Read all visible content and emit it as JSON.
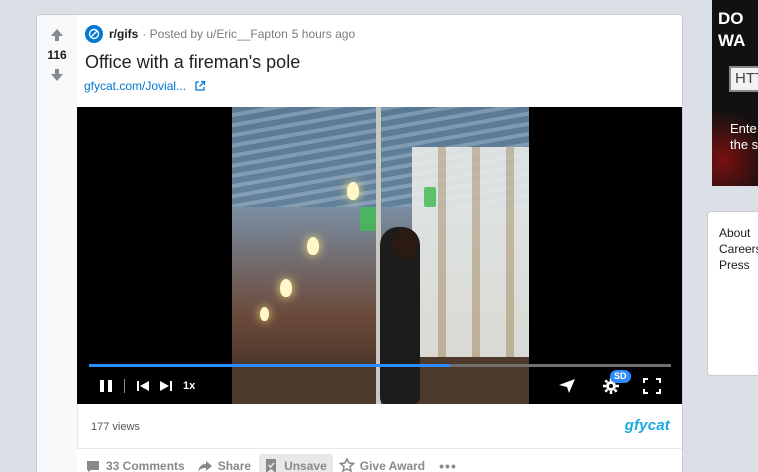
{
  "post": {
    "score": "116",
    "subreddit": "r/gifs",
    "posted_by": "· Posted by u/Eric__Fapton",
    "time_ago": "5 hours ago",
    "title": "Office with a fireman's pole",
    "link_text": "gfycat.com/Jovial...",
    "video": {
      "progress": 0.62,
      "speed_label": "1x",
      "quality_badge": "SD",
      "views": "177 views",
      "provider_logo": "gfycat"
    },
    "actions": {
      "comments": "33 Comments",
      "share": "Share",
      "unsave": "Unsave",
      "give_award": "Give Award",
      "more": "•••"
    }
  },
  "ad": {
    "headline_line1": "DO",
    "headline_line2": "WA",
    "input_text": "HTT",
    "sub_line1": "Ente",
    "sub_line2": "the s"
  },
  "sidebar_footer": {
    "links": [
      "About",
      "Careers",
      "Press"
    ]
  },
  "colors": {
    "page_bg": "#dae0e6",
    "accent_blue": "#0079d3",
    "progress_blue": "#2d8cff",
    "gfycat_blue": "#1ba8e0"
  }
}
